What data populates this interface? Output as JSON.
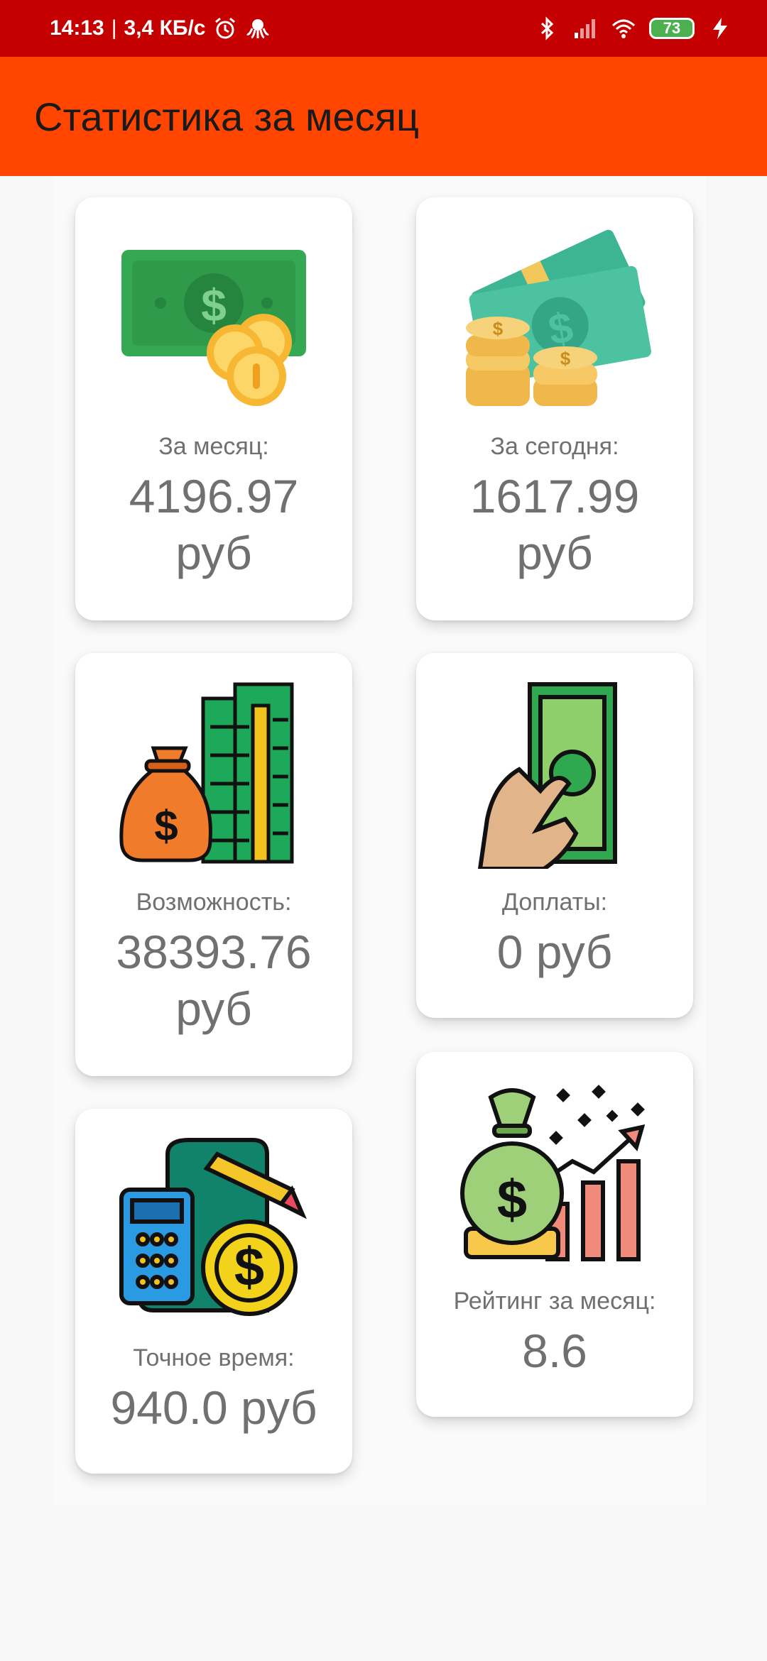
{
  "status_bar": {
    "time": "14:13",
    "separator": "|",
    "network_speed": "3,4 КБ/с",
    "battery_level": "73",
    "icons": [
      "alarm-icon",
      "octopus-icon",
      "bluetooth-icon",
      "signal-icon",
      "wifi-icon",
      "battery-icon",
      "charging-icon"
    ]
  },
  "app_bar": {
    "title": "Статистика за месяц",
    "color": "#ff4500",
    "status_color": "#c40000"
  },
  "cards": [
    {
      "icon": "cash-coins-icon",
      "label": "За месяц:",
      "value": "4196.97 руб"
    },
    {
      "icon": "money-stack-icon",
      "label": "За сегодня:",
      "value": "1617.99 руб"
    },
    {
      "icon": "money-bag-stacks-icon",
      "label": "Возможность:",
      "value": "38393.76 руб"
    },
    {
      "icon": "hand-banknote-icon",
      "label": "Доплаты:",
      "value": "0 руб"
    },
    {
      "icon": "calculator-coin-icon",
      "label": "Точное время:",
      "value": "940.0 руб"
    },
    {
      "icon": "growth-money-bag-icon",
      "label": "Рейтинг за месяц:",
      "value": "8.6"
    }
  ]
}
